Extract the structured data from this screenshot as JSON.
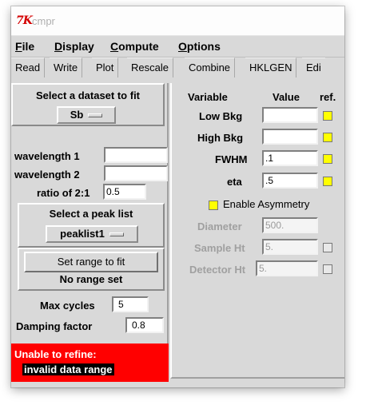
{
  "window": {
    "title": "cmpr"
  },
  "menus": [
    "File",
    "Display",
    "Compute",
    "Options"
  ],
  "menu_underline": [
    "F",
    "D",
    "C",
    "O"
  ],
  "tabs": [
    "Read",
    "Write",
    "Plot",
    "Rescale",
    "Combine",
    "HKLGEN",
    "Edi"
  ],
  "left": {
    "dataset_title": "Select a dataset to fit",
    "dataset_value": "Sb",
    "wavelength1_label": "wavelength 1",
    "wavelength1_value": "",
    "wavelength2_label": "wavelength 2",
    "wavelength2_value": "",
    "ratio_label": "ratio of 2:1",
    "ratio_value": "0.5",
    "peaklist_title": "Select a peak list",
    "peaklist_value": "peaklist1",
    "set_range_button": "Set range to fit",
    "range_status": "No range set",
    "max_cycles_label": "Max cycles",
    "max_cycles_value": "5",
    "damping_label": "Damping factor",
    "damping_value": "0.8",
    "error_title": "Unable to refine:",
    "error_message": "invalid data range"
  },
  "right": {
    "col_variable": "Variable",
    "col_value": "Value",
    "col_ref": "ref.",
    "rows": [
      {
        "label": "Low Bkg",
        "value": "",
        "checked": true
      },
      {
        "label": "High Bkg",
        "value": "",
        "checked": true
      },
      {
        "label": "FWHM",
        "value": ".1",
        "checked": true
      },
      {
        "label": "eta",
        "value": ".5",
        "checked": true
      }
    ],
    "asym_label": "Enable Asymmetry",
    "asym_checked": true,
    "disabled_rows": [
      {
        "label": "Diameter",
        "value": "500."
      },
      {
        "label": "Sample Ht",
        "value": "5."
      },
      {
        "label": "Detector Ht",
        "value": "5."
      }
    ]
  },
  "colors": {
    "error_bg": "#ff0000",
    "check_on": "#ffff00",
    "panel_bg": "#d9d9d9"
  }
}
